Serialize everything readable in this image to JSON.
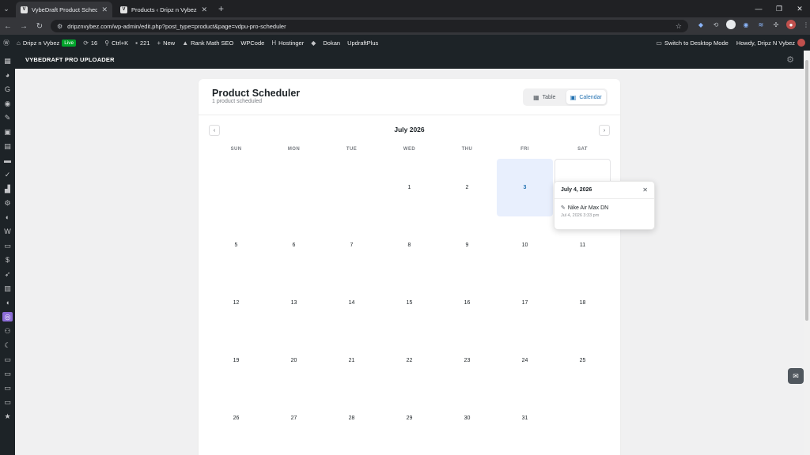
{
  "browser": {
    "tabs": [
      {
        "title": "VybeDraft Product Scheduler ‹ D",
        "active": true
      },
      {
        "title": "Products ‹ Dripz n Vybez — Wo",
        "active": false
      }
    ],
    "url": "dripznvybez.com/wp-admin/edit.php?post_type=product&page=vdpu-pro-scheduler"
  },
  "wpbar": {
    "site_name": "Dripz n Vybez",
    "live": "Live",
    "updates": "16",
    "shortcut": "Ctrl+K",
    "comments": "221",
    "new": "New",
    "rankmath": "Rank Math SEO",
    "wpcode": "WPCode",
    "hostinger": "Hostinger",
    "dokan": "Dokan",
    "updraft": "UpdraftPlus",
    "desktop_mode": "Switch to Desktop Mode",
    "howdy": "Howdy, Dripz N Vybez"
  },
  "plugin": {
    "name": "VYBEDRAFT PRO UPLOADER"
  },
  "scheduler": {
    "title": "Product Scheduler",
    "subtitle": "1 product scheduled",
    "view_table": "Table",
    "view_calendar": "Calendar",
    "active_view": "Calendar",
    "month": "July 2026",
    "weekdays": [
      "SUN",
      "MON",
      "TUE",
      "WED",
      "THU",
      "FRI",
      "SAT"
    ],
    "weeks": [
      [
        "",
        "",
        "",
        "1",
        "2",
        "3",
        ""
      ],
      [
        "5",
        "6",
        "7",
        "8",
        "9",
        "10",
        "11"
      ],
      [
        "12",
        "13",
        "14",
        "15",
        "16",
        "17",
        "18"
      ],
      [
        "19",
        "20",
        "21",
        "22",
        "23",
        "24",
        "25"
      ],
      [
        "26",
        "27",
        "28",
        "29",
        "30",
        "31",
        ""
      ]
    ],
    "highlighted_day": "3"
  },
  "popover": {
    "date": "July 4, 2026",
    "product_name": "Nike Air Max DN",
    "product_time": "Jul 4, 2026 3:33 pm"
  },
  "colors": {
    "accent": "#2271b1",
    "highlight": "#e8effd",
    "wp_dark": "#1d2327",
    "plugin_purple": "#8c6dd7"
  }
}
